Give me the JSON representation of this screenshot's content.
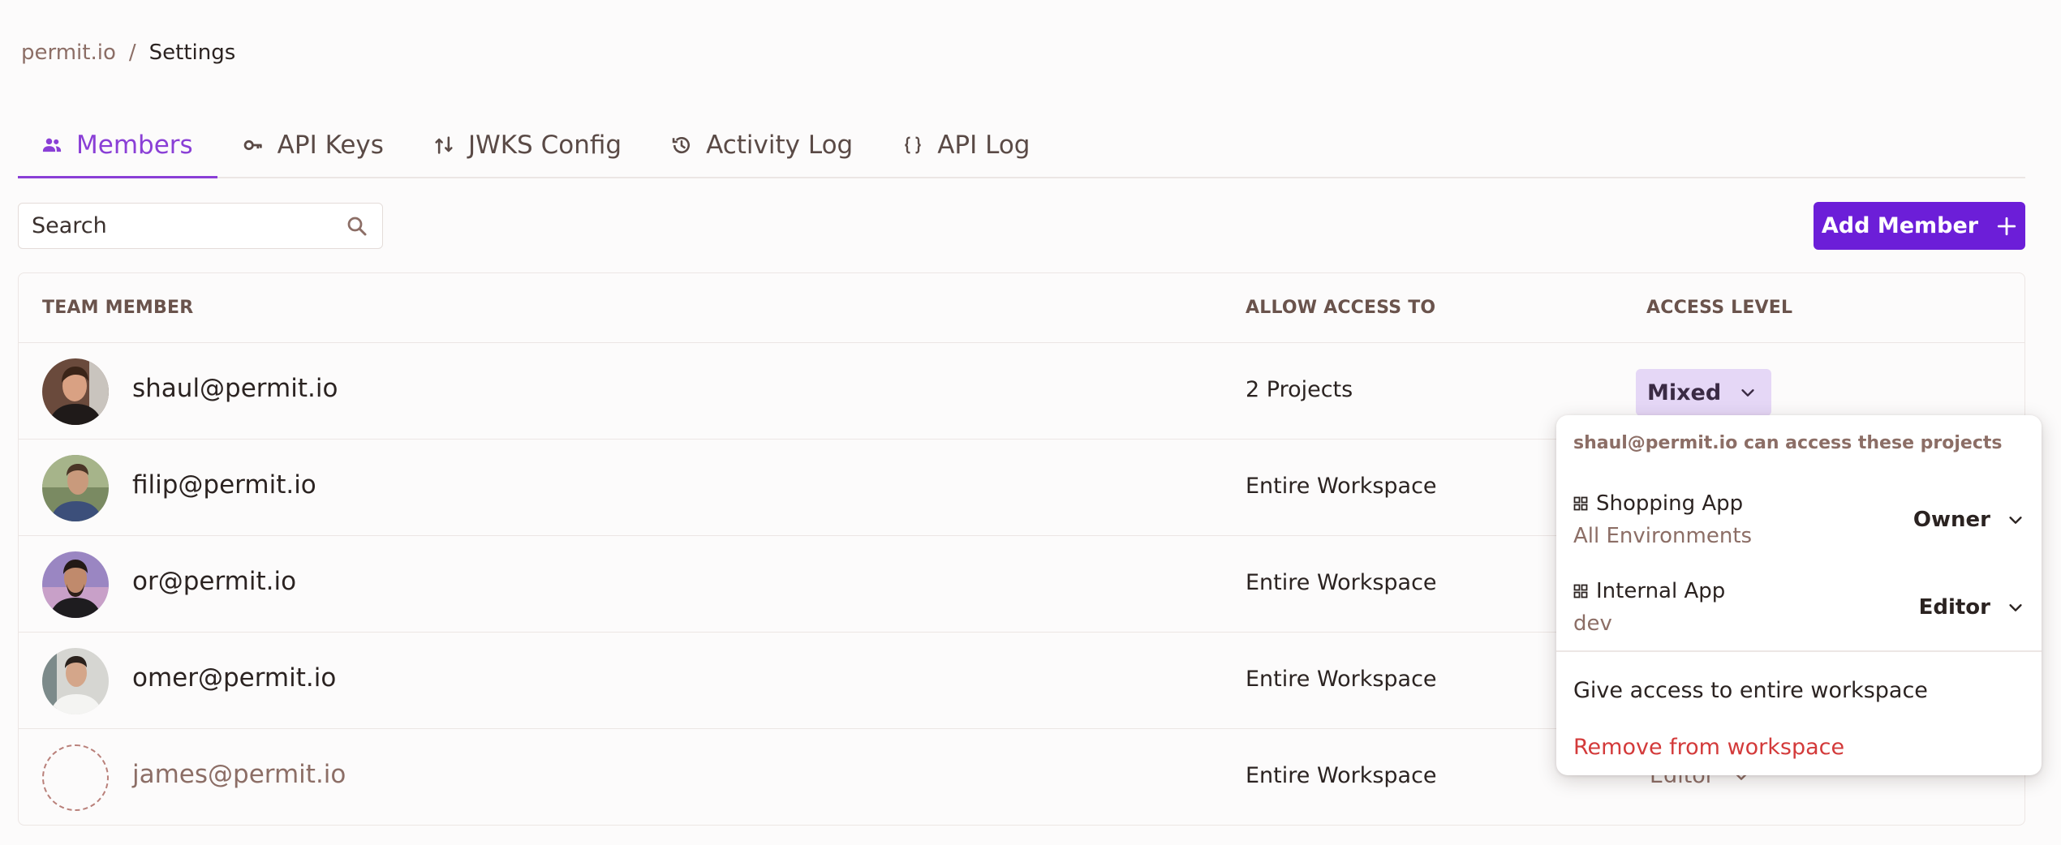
{
  "breadcrumb": {
    "org": "permit.io",
    "separator": "/",
    "current": "Settings"
  },
  "tabs": [
    {
      "label": "Members",
      "icon": "people-icon",
      "active": true
    },
    {
      "label": "API Keys",
      "icon": "key-icon",
      "active": false
    },
    {
      "label": "JWKS Config",
      "icon": "config-arrows-icon",
      "active": false
    },
    {
      "label": "Activity Log",
      "icon": "history-icon",
      "active": false
    },
    {
      "label": "API Log",
      "icon": "braces-icon",
      "active": false
    }
  ],
  "search": {
    "placeholder": "Search",
    "value": ""
  },
  "add_member_label": "Add Member",
  "table": {
    "headers": {
      "member": "TEAM MEMBER",
      "access": "ALLOW ACCESS TO",
      "level": "ACCESS LEVEL"
    },
    "rows": [
      {
        "email": "shaul@permit.io",
        "access": "2 Projects",
        "level": "Mixed"
      },
      {
        "email": "filip@permit.io",
        "access": "Entire Workspace",
        "level": ""
      },
      {
        "email": "or@permit.io",
        "access": "Entire Workspace",
        "level": ""
      },
      {
        "email": "omer@permit.io",
        "access": "Entire Workspace",
        "level": ""
      },
      {
        "email": "james@permit.io",
        "access": "Entire Workspace",
        "level": "Editor"
      }
    ]
  },
  "popover": {
    "title": "shaul@permit.io can access these projects",
    "projects": [
      {
        "name": "Shopping App",
        "env": "All Environments",
        "role": "Owner"
      },
      {
        "name": "Internal App",
        "env": "dev",
        "role": "Editor"
      }
    ],
    "give_access_label": "Give access to entire workspace",
    "remove_label": "Remove from workspace"
  },
  "colors": {
    "accent": "#8a3fd6",
    "button": "#6c1ed8",
    "danger": "#d33a3a",
    "muted": "#8c6e66"
  }
}
